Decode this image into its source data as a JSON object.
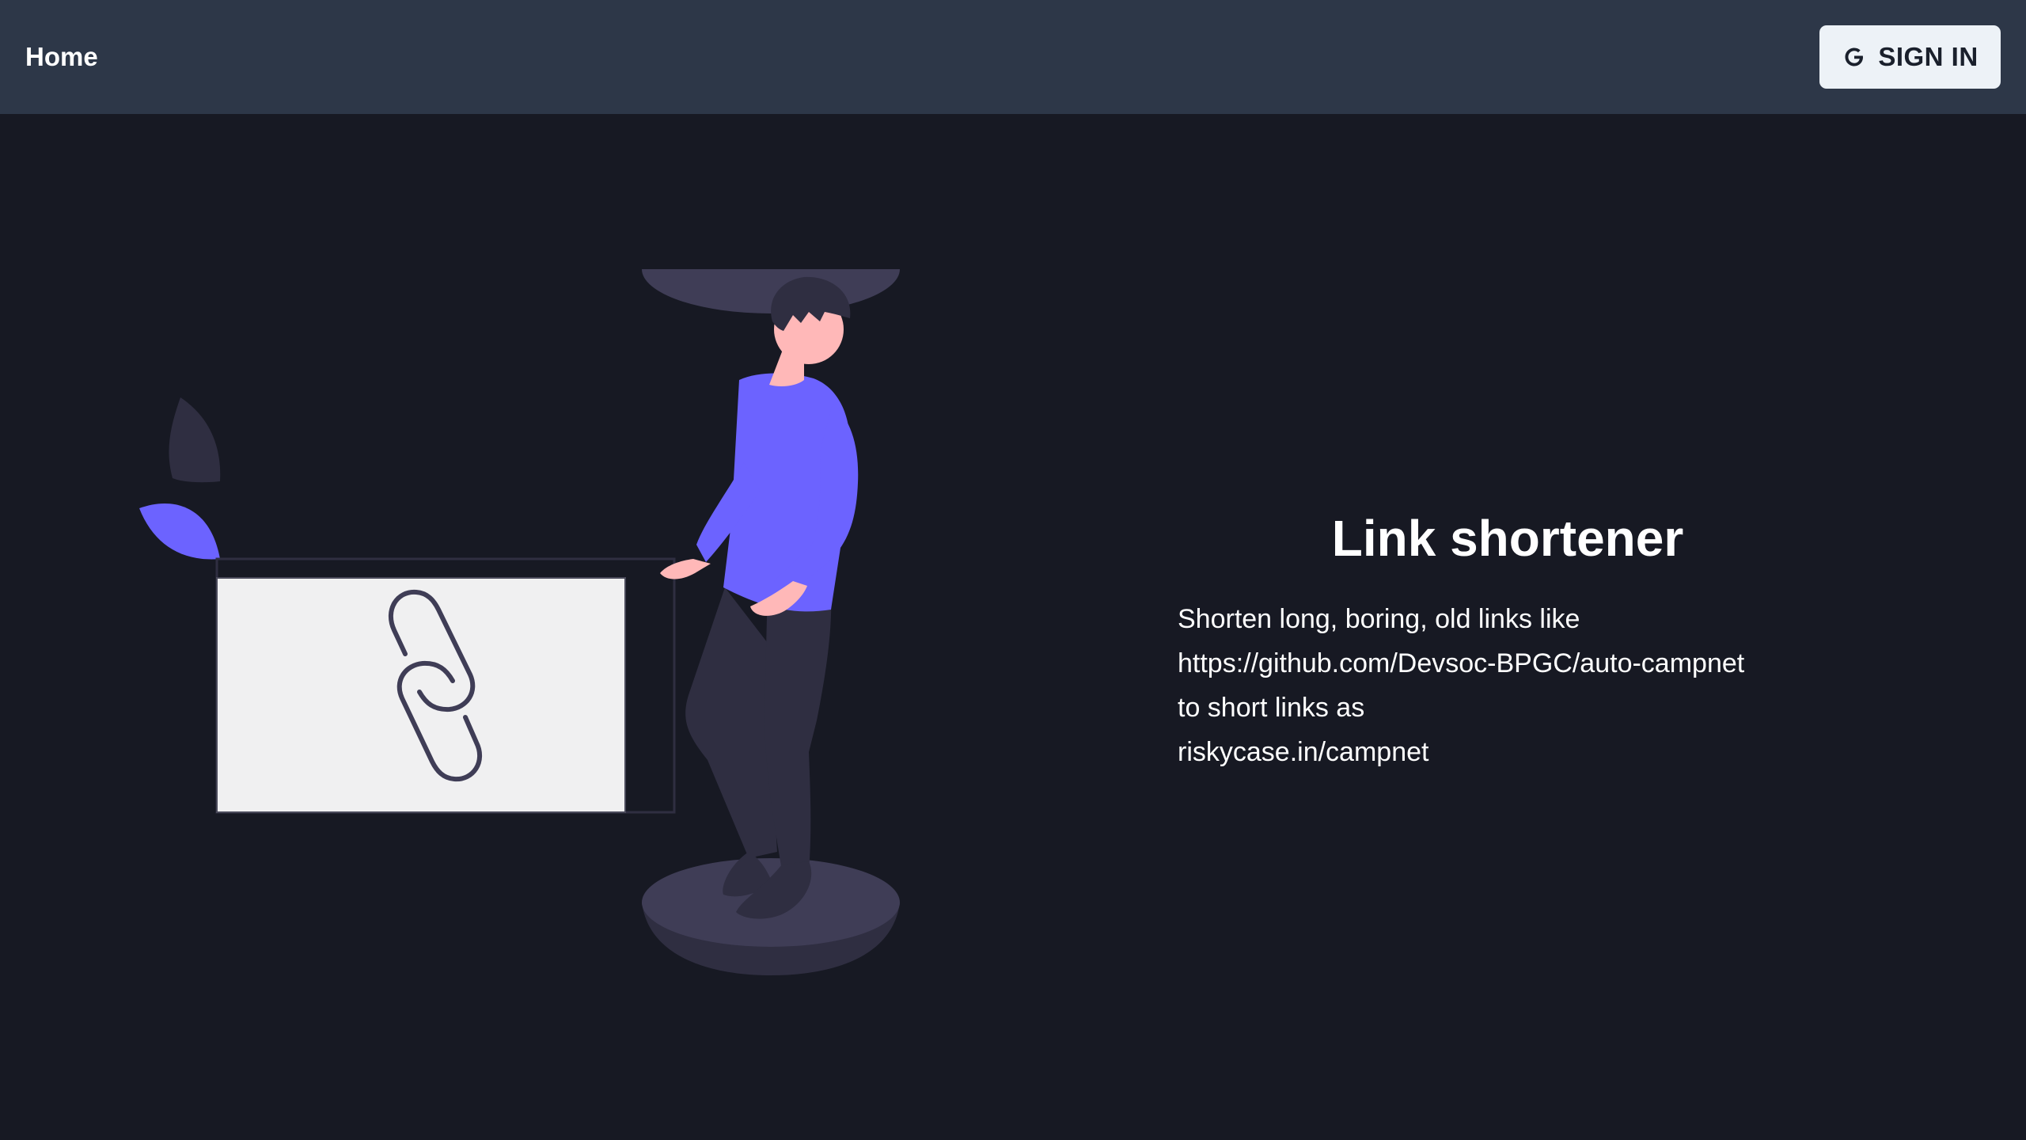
{
  "navbar": {
    "home_label": "Home",
    "signin_label": "SIGN IN",
    "signin_icon": "google-g-icon"
  },
  "illustration": {
    "icon": "chain-link-icon",
    "accent_color": "#6c63ff",
    "skin_color": "#ffb8b8",
    "dark_color": "#2f2e41",
    "card_color": "#f0f0f1"
  },
  "hero": {
    "title": "Link shortener",
    "lines": [
      "Shorten long, boring, old links like",
      "https://github.com/Devsoc-BPGC/auto-campnet",
      "to short links as",
      "riskycase.in/campnet"
    ]
  },
  "colors": {
    "navbar_bg": "#2d3748",
    "page_bg": "#171923",
    "button_bg": "#edf2f7",
    "button_text": "#1a202c"
  }
}
